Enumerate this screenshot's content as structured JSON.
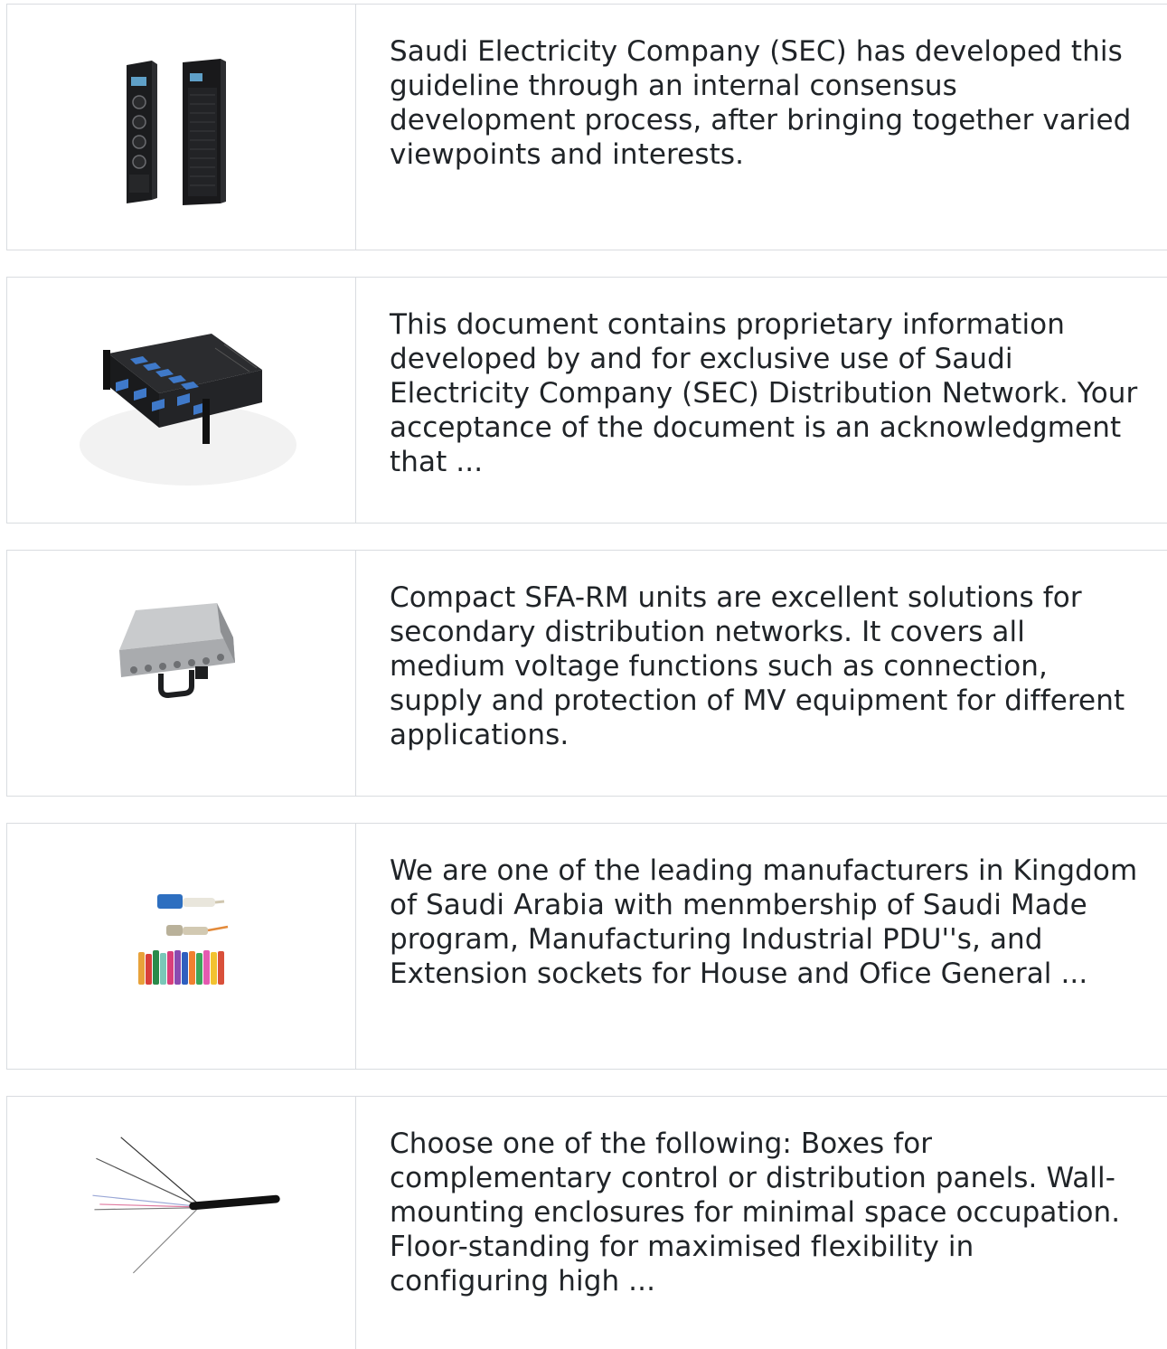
{
  "items": [
    {
      "image_icon": "cooling-cabinet-product-icon",
      "description": "Saudi Electricity Company (SEC) has developed this guideline through an internal consensus development process, after bringing together varied viewpoints and interests."
    },
    {
      "image_icon": "fiber-patch-panel-product-icon",
      "description": "This document contains proprietary information developed by and for exclusive use of Saudi Electricity Company (SEC) Distribution Network. Your acceptance of the document is an acknowledgment that ..."
    },
    {
      "image_icon": "sfa-rm-unit-product-icon",
      "description": "Compact SFA-RM units are excellent solutions for secondary distribution networks. It covers all medium voltage functions such as connection, supply and protection of MV equipment for different applications."
    },
    {
      "image_icon": "fiber-connectors-product-icon",
      "description": "We are one of the leading manufacturers in Kingdom of Saudi Arabia with menmbership of Saudi Made program, Manufacturing Industrial PDU''s, and Extension sockets for House and Ofice General ..."
    },
    {
      "image_icon": "multicore-cable-product-icon",
      "description": "Choose one of the following: Boxes for complementary control or distribution panels. Wall-mounting enclosures for minimal space occupation. Floor-standing for maximised flexibility in configuring high ..."
    }
  ]
}
